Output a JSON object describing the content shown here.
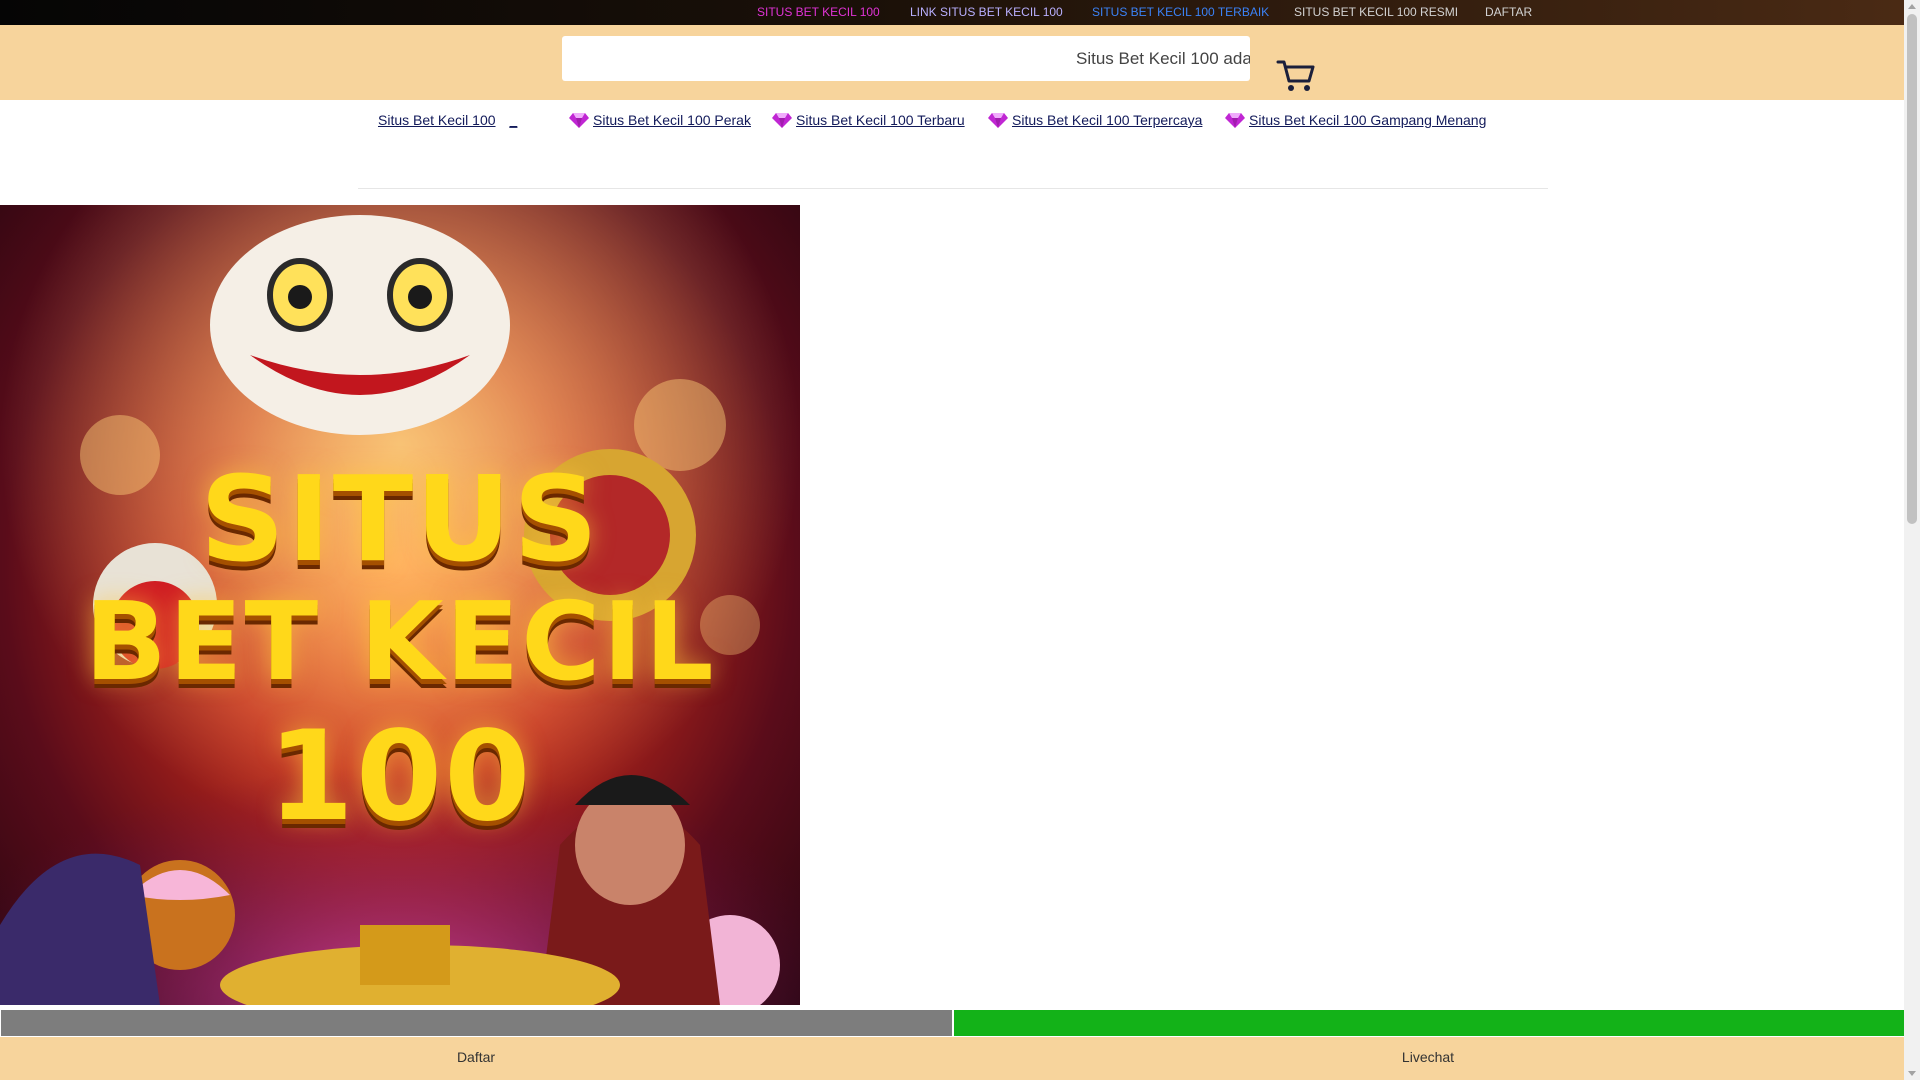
{
  "topbar": {
    "links": [
      {
        "label": "SITUS BET KECIL 100",
        "color": "#e033d6"
      },
      {
        "label": "LINK SITUS BET KECIL 100",
        "color": "#b9b0ff"
      },
      {
        "label": "SITUS BET KECIL 100 TERBAIK",
        "color": "#3b82f6"
      },
      {
        "label": "SITUS BET KECIL 100 RESMI",
        "color": "#d2d2d2"
      },
      {
        "label": "DAFTAR",
        "color": "#d2d2d2"
      }
    ]
  },
  "header": {
    "search_value": "Situs Bet Kecil 100 adala",
    "cart_icon": "shopping-cart-icon"
  },
  "nav": {
    "first_label": "Situs Bet Kecil 100",
    "first_suffix": "_",
    "items": [
      {
        "label": "Situs Bet Kecil 100 Perak",
        "icon": "diamond-icon"
      },
      {
        "label": "Situs Bet Kecil 100 Terbaru",
        "icon": "diamond-icon"
      },
      {
        "label": "Situs Bet Kecil 100 Terpercaya",
        "icon": "diamond-icon"
      },
      {
        "label": "Situs Bet Kecil 100 Gampang Menang",
        "icon": "diamond-icon"
      }
    ]
  },
  "banner": {
    "line1": "SITUS",
    "line2": "BET KECIL",
    "line3": "100"
  },
  "bottom": {
    "daftar_label": "Daftar",
    "livechat_label": "Livechat"
  },
  "colors": {
    "header_bg": "#f7d49c",
    "register_button": "#7d7d7d",
    "livechat_button": "#13b218",
    "nav_text": "#121a5a",
    "gem": "#c026d3"
  }
}
